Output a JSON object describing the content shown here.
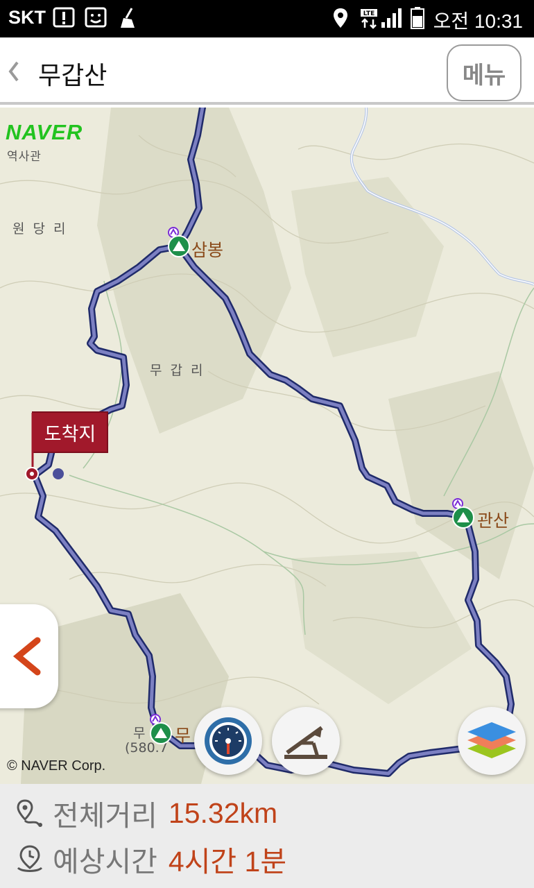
{
  "status_bar": {
    "carrier": "SKT",
    "network": "LTE",
    "time": "오전 10:31"
  },
  "header": {
    "title": "무갑산",
    "menu_label": "메뉴"
  },
  "map": {
    "logo": "NAVER",
    "copyright": "© NAVER Corp.",
    "place_labels": {
      "partial_top": "역사관",
      "wondang": "원 당 리",
      "mugap": "무 갑 리",
      "partial_bottom_a": "무",
      "partial_bottom_elev": "(580.7"
    },
    "peaks": {
      "sambong": "삼봉",
      "gwansan": "관산",
      "mugap_peak_partial": "무"
    },
    "arrival_tag": "도착지"
  },
  "route_info": {
    "distance_label": "전체거리",
    "distance_value": "15.32km",
    "time_label": "예상시간",
    "time_value": "4시간 1분"
  },
  "colors": {
    "route": "#4b4f9a",
    "arrival": "#a1192b",
    "accent": "#c0431a",
    "peak_marker": "#1e8f4a"
  }
}
